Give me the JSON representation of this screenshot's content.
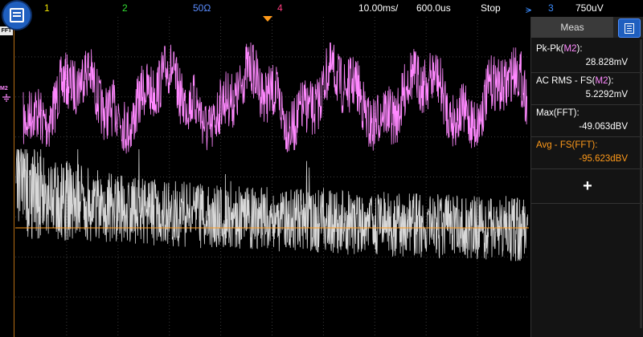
{
  "topbar": {
    "ch1": "1",
    "ch2": "2",
    "impedance": "50Ω",
    "ch4": "4",
    "timebase": "10.00ms/",
    "delay": "600.0us",
    "run_state": "Stop",
    "trig_channel": "3",
    "trig_level": "750uV"
  },
  "labels": {
    "fft": "FFT",
    "math": "M2"
  },
  "panel": {
    "tab": "Meas",
    "measurements": [
      {
        "name": "Pk-Pk(",
        "src": "M2",
        "tail": "):",
        "value": "28.828mV"
      },
      {
        "name": "AC RMS - FS(",
        "src": "M2",
        "tail": "):",
        "value": "5.2292mV"
      },
      {
        "name": "Max(FFT):",
        "src": "",
        "tail": "",
        "value": "-49.063dBV"
      },
      {
        "name": "Avg - FS(FFT):",
        "src": "",
        "tail": "",
        "value": "-95.623dBV"
      }
    ],
    "add_label": "+"
  },
  "colors": {
    "ch1": "#f2e600",
    "ch2": "#33e033",
    "impedance": "#5a8cff",
    "ch4": "#ff3c7f",
    "math": "#ff88ff",
    "fft": "#d8d8d8",
    "accent": "#ff9a1a"
  },
  "icons": {
    "menu": "menu-icon",
    "panel": "list-icon",
    "trigger": "rising-edge-icon"
  }
}
